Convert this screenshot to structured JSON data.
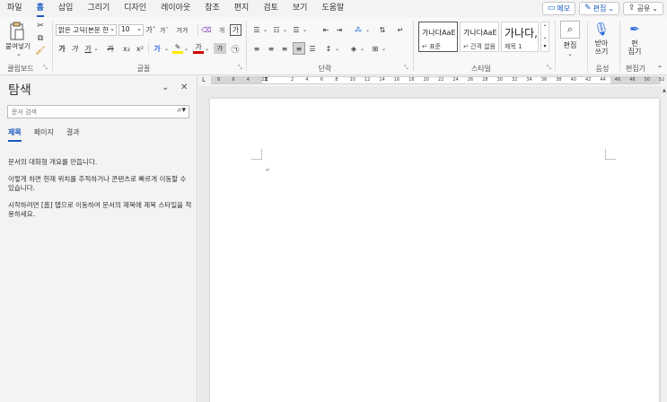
{
  "menu": {
    "tabs": [
      "파일",
      "홈",
      "삽입",
      "그리기",
      "디자인",
      "레이아웃",
      "참조",
      "편지",
      "검토",
      "보기",
      "도움말"
    ],
    "active_tab": "홈",
    "memo_label": "메모",
    "edit_label": "편집",
    "share_label": "공유"
  },
  "ribbon": {
    "clipboard": {
      "label": "클립보드",
      "paste_label": "붙여넣기"
    },
    "font": {
      "label": "글꼴",
      "font_name": "맑은 고딕(본문 한",
      "font_size": "10",
      "bold": "가",
      "italic": "가",
      "underline": "가",
      "strike": "가",
      "subscript": "x₂",
      "superscript": "x²",
      "grow": "가ˆ",
      "shrink": "가ˇ",
      "case": "가가",
      "phonetic": "개",
      "border_char": "가"
    },
    "paragraph": {
      "label": "단락"
    },
    "styles": {
      "label": "스타일",
      "items": [
        {
          "sample": "가나다AaE",
          "name": "↵ 표준"
        },
        {
          "sample": "가나다AaE",
          "name": "↵ 간격 없음"
        },
        {
          "sample": "가나다,",
          "name": "제목 1"
        }
      ]
    },
    "editing": {
      "label": "편집"
    },
    "voice": {
      "label": "음성",
      "dictate": "받아\n쓰기"
    },
    "editor": {
      "label": "편집기",
      "name": "편\n집기"
    }
  },
  "nav": {
    "title": "탐색",
    "search_placeholder": "문서 검색",
    "tabs": [
      "제목",
      "페이지",
      "결과"
    ],
    "active_tab": "제목",
    "para1": "문서의 대화형 개요를 만듭니다.",
    "para2": "이렇게 하면 현재 위치를 추적하거나 콘텐츠로 빠르게 이동할 수 있습니다.",
    "para3": "시작하려면 [홈] 탭으로 이동하여 문서의 제목에 제목 스타일을 적용하세요."
  },
  "ruler": {
    "ticks": [
      "8",
      "6",
      "4",
      "2",
      "",
      "2",
      "4",
      "6",
      "8",
      "10",
      "12",
      "14",
      "16",
      "18",
      "20",
      "22",
      "24",
      "26",
      "28",
      "30",
      "32",
      "34",
      "36",
      "38",
      "40",
      "42",
      "44",
      "46",
      "48",
      "50",
      "52"
    ]
  },
  "colors": {
    "accent": "#185abd"
  }
}
